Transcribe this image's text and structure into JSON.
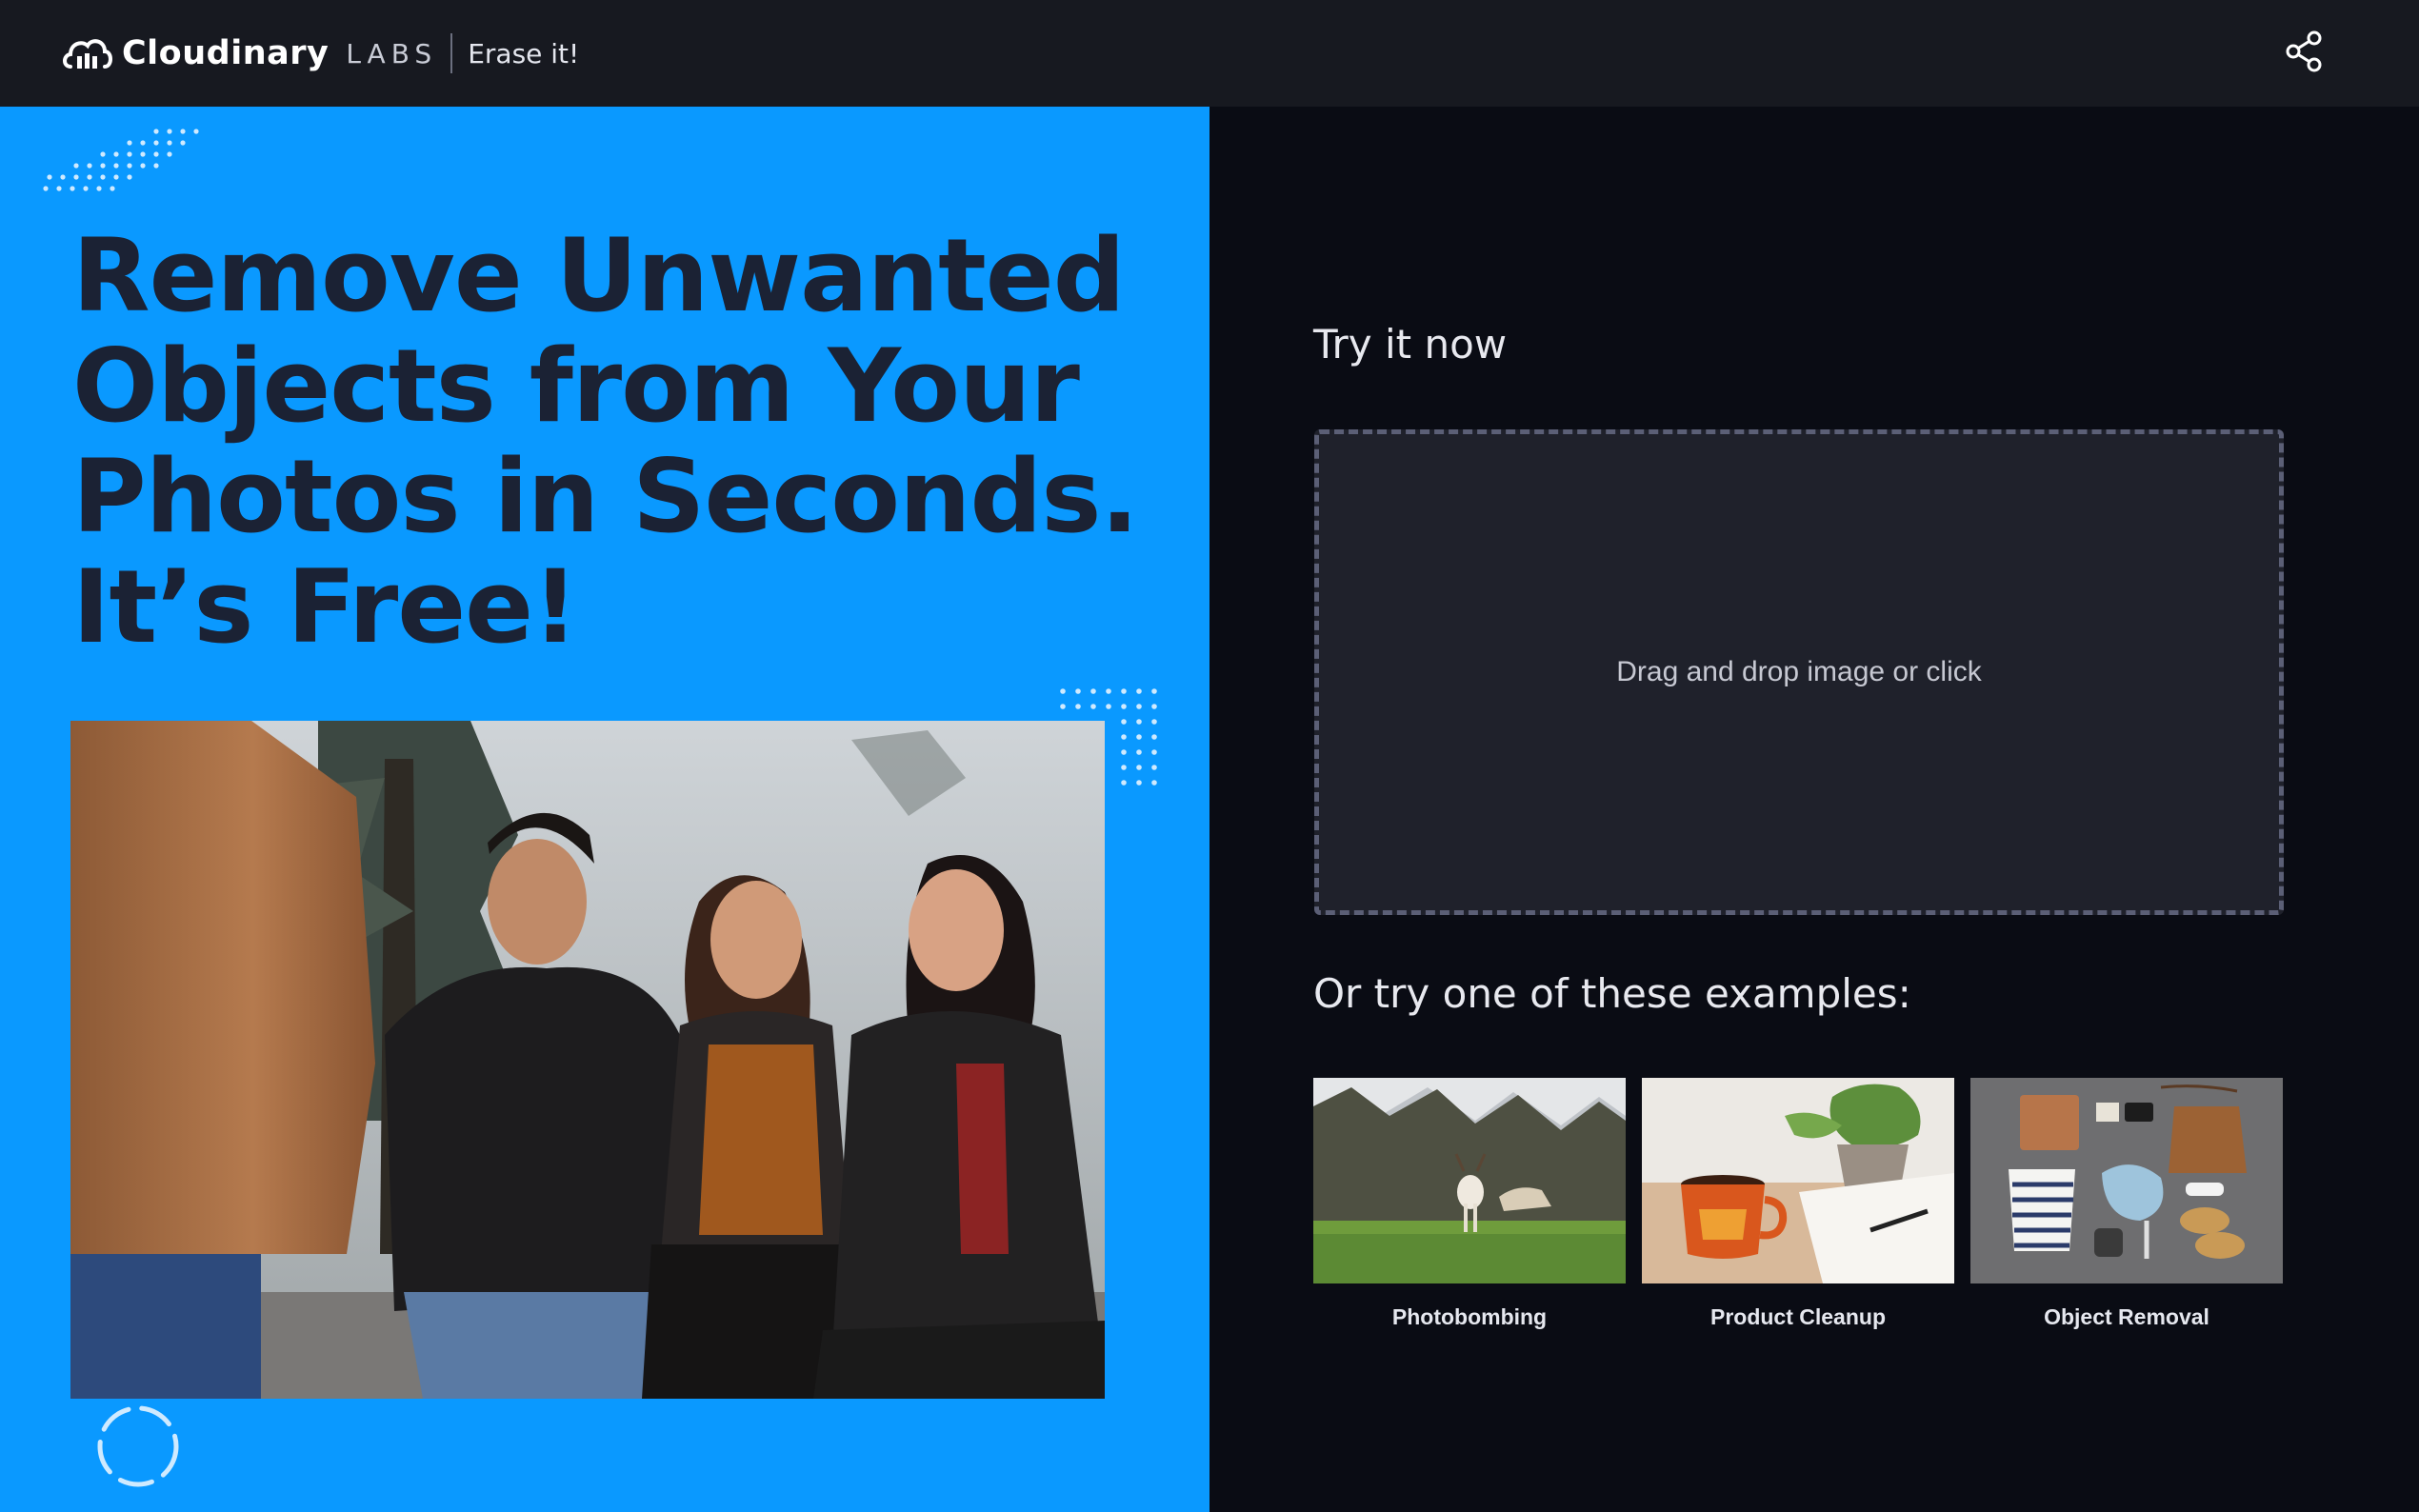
{
  "header": {
    "brand_name": "Cloudinary",
    "brand_labs": "LABS",
    "product_name": "Erase it!",
    "logo_icon": "cloudinary-cloud-logo",
    "share_icon": "share-icon"
  },
  "hero": {
    "title_lines": [
      "Remove Unwanted",
      "Objects from Your",
      "Photos in Seconds.",
      "It’s Free!"
    ],
    "background_color": "#0a99ff",
    "title_color": "#1b2234",
    "photo": "group-photo-four-friends-laughing",
    "loader_icon": "loading-spinner-icon"
  },
  "panel": {
    "try_title": "Try it now",
    "dropzone_text": "Drag and drop image or click",
    "examples_title": "Or try one of these examples:",
    "examples": [
      {
        "label": "Photobombing",
        "thumb": "deer-in-park"
      },
      {
        "label": "Product Cleanup",
        "thumb": "coffee-mug-notebook"
      },
      {
        "label": "Object Removal",
        "thumb": "flatlay-items"
      }
    ]
  },
  "colors": {
    "topbar": "#171920",
    "panel_background": "#0a0c14",
    "dropzone_background": "#1f212b",
    "dropzone_border": "#5b5f76"
  }
}
